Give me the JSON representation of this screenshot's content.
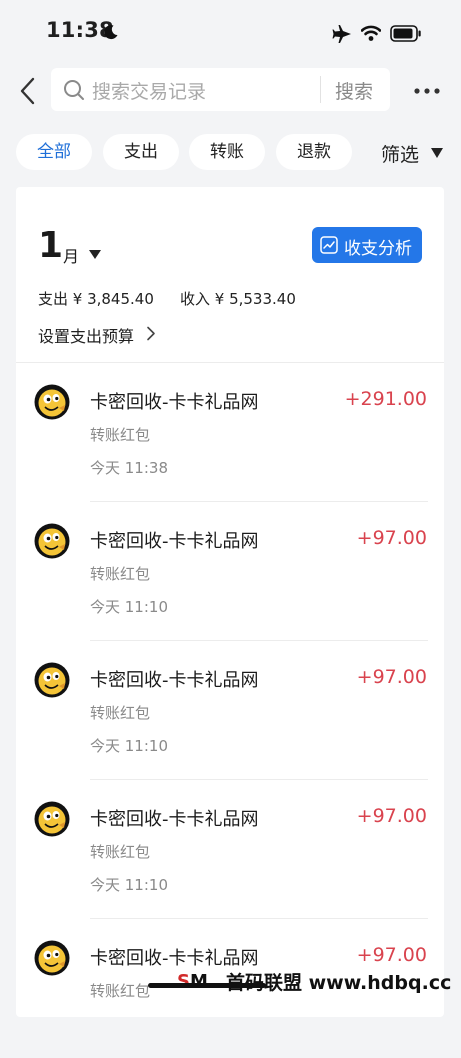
{
  "status_bar": {
    "time": "11:38",
    "icons": [
      "moon-icon",
      "airplane-icon",
      "wifi-icon",
      "battery-icon"
    ]
  },
  "search": {
    "placeholder": "搜索交易记录",
    "button_label": "搜索"
  },
  "filters": {
    "chips": [
      "全部",
      "支出",
      "转账",
      "退款"
    ],
    "active_index": 0,
    "filter_label": "筛选",
    "active_color": "#1f6fd8"
  },
  "summary": {
    "month_number": "1",
    "month_unit": "月",
    "analysis_label": "收支分析",
    "expense": "支出 ¥ 3,845.40",
    "income": "收入 ¥ 5,533.40",
    "budget_link": "设置支出预算",
    "accent_color": "#2477e8"
  },
  "transactions": [
    {
      "name": "卡密回收-卡卡礼品网",
      "type": "转账红包",
      "time": "今天 11:38",
      "amount": "+291.00"
    },
    {
      "name": "卡密回收-卡卡礼品网",
      "type": "转账红包",
      "time": "今天 11:10",
      "amount": "+97.00"
    },
    {
      "name": "卡密回收-卡卡礼品网",
      "type": "转账红包",
      "time": "今天 11:10",
      "amount": "+97.00"
    },
    {
      "name": "卡密回收-卡卡礼品网",
      "type": "转账红包",
      "time": "今天 11:10",
      "amount": "+97.00"
    },
    {
      "name": "卡密回收-卡卡礼品网",
      "type": "转账红包",
      "time": "",
      "amount": "+97.00"
    }
  ],
  "colors": {
    "income_amount": "#d9434e",
    "background": "#f3f4f6"
  },
  "watermark": {
    "text": "首码联盟 www.hdbq.cc",
    "logo_text": "SM"
  }
}
